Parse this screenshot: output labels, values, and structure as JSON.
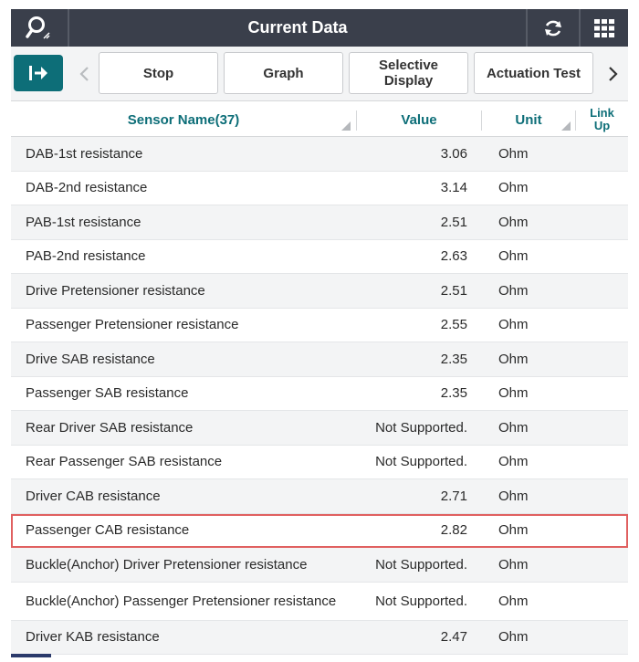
{
  "header": {
    "title": "Current Data",
    "search_icon": "search-icon",
    "refresh_icon": "refresh-icon",
    "grid_icon": "grid-menu-icon"
  },
  "toolbar": {
    "exit_icon": "exit-arrow-icon",
    "prev_icon": "chevron-left-icon",
    "stop_label": "Stop",
    "graph_label": "Graph",
    "selective_display_line1": "Selective",
    "selective_display_line2": "Display",
    "actuation_test_label": "Actuation Test",
    "next_icon": "chevron-right-icon"
  },
  "table": {
    "columns": {
      "sensor_name": "Sensor Name(37)",
      "value": "Value",
      "unit": "Unit",
      "link_up_line1": "Link",
      "link_up_line2": "Up"
    },
    "rows": [
      {
        "name": "DAB-1st resistance",
        "value": "3.06",
        "unit": "Ohm"
      },
      {
        "name": "DAB-2nd resistance",
        "value": "3.14",
        "unit": "Ohm"
      },
      {
        "name": "PAB-1st resistance",
        "value": "2.51",
        "unit": "Ohm"
      },
      {
        "name": "PAB-2nd resistance",
        "value": "2.63",
        "unit": "Ohm"
      },
      {
        "name": "Drive Pretensioner resistance",
        "value": "2.51",
        "unit": "Ohm"
      },
      {
        "name": "Passenger Pretensioner resistance",
        "value": "2.55",
        "unit": "Ohm"
      },
      {
        "name": "Drive SAB resistance",
        "value": "2.35",
        "unit": "Ohm"
      },
      {
        "name": "Passenger SAB resistance",
        "value": "2.35",
        "unit": "Ohm"
      },
      {
        "name": "Rear Driver SAB resistance",
        "value": "Not Supported.",
        "unit": "Ohm"
      },
      {
        "name": "Rear Passenger SAB resistance",
        "value": "Not Supported.",
        "unit": "Ohm"
      },
      {
        "name": "Driver CAB resistance",
        "value": "2.71",
        "unit": "Ohm"
      },
      {
        "name": "Passenger CAB resistance",
        "value": "2.82",
        "unit": "Ohm",
        "selected": true
      },
      {
        "name": "Buckle(Anchor) Driver Pretensioner resistance",
        "value": "Not Supported.",
        "unit": "Ohm"
      },
      {
        "name": "Buckle(Anchor) Passenger Pretensioner resistance",
        "value": "Not Supported.",
        "unit": "Ohm"
      },
      {
        "name": "Driver KAB resistance",
        "value": "2.47",
        "unit": "Ohm"
      }
    ]
  },
  "colors": {
    "titlebar_bg": "#3a3f4b",
    "accent_teal": "#0d6e78",
    "selected_border": "#e06060",
    "alt_row_bg": "#f3f4f5"
  }
}
